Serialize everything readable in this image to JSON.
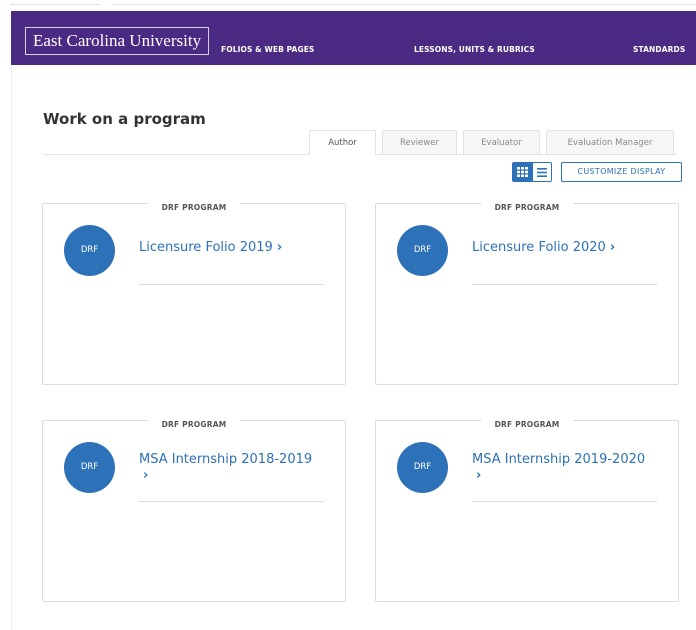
{
  "header": {
    "logo": "East Carolina University",
    "nav": [
      "FOLIOS & WEB PAGES",
      "LESSONS, UNITS & RUBRICS",
      "STANDARDS"
    ]
  },
  "page": {
    "title": "Work on a program"
  },
  "tabs": [
    {
      "label": "Author",
      "active": true
    },
    {
      "label": "Reviewer",
      "active": false
    },
    {
      "label": "Evaluator",
      "active": false
    },
    {
      "label": "Evaluation Manager",
      "active": false
    }
  ],
  "toolbar": {
    "customize_label": "CUSTOMIZE DISPLAY",
    "grid_icon": "grid-icon",
    "list_icon": "list-icon"
  },
  "programs": [
    {
      "type": "DRF PROGRAM",
      "avatar": "DRF",
      "name": "Licensure Folio 2019",
      "chevron": "›"
    },
    {
      "type": "DRF PROGRAM",
      "avatar": "DRF",
      "name": "Licensure Folio 2020",
      "chevron": "›"
    },
    {
      "type": "DRF PROGRAM",
      "avatar": "DRF",
      "name": "MSA Internship 2018-2019",
      "chevron": "›"
    },
    {
      "type": "DRF PROGRAM",
      "avatar": "DRF",
      "name": "MSA Internship 2019-2020",
      "chevron": "›"
    }
  ],
  "colors": {
    "header_bg": "#4b2a84",
    "accent": "#2d71b8"
  }
}
